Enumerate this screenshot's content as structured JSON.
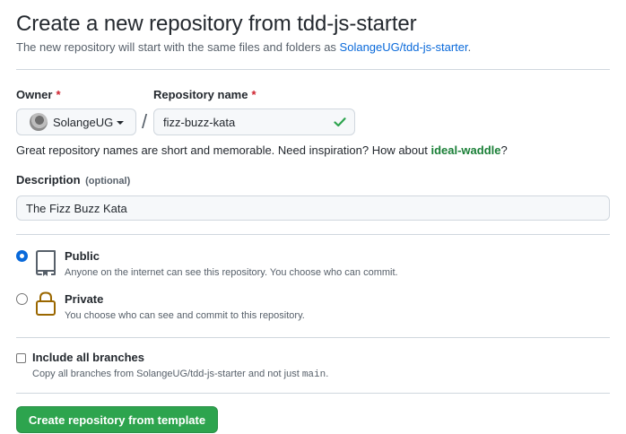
{
  "header": {
    "title": "Create a new repository from tdd-js-starter",
    "subtitle_prefix": "The new repository will start with the same files and folders as ",
    "template_link": "SolangeUG/tdd-js-starter",
    "subtitle_suffix": "."
  },
  "owner": {
    "label": "Owner",
    "required_mark": "*",
    "value": "SolangeUG"
  },
  "separator": "/",
  "repository": {
    "label": "Repository name",
    "required_mark": "*",
    "value": "fizz-buzz-kata",
    "valid_icon": "check-icon",
    "hint_prefix": "Great repository names are short and memorable. Need inspiration? How about ",
    "suggestion": "ideal-waddle",
    "hint_suffix": "?"
  },
  "description": {
    "label": "Description",
    "optional": "(optional)",
    "value": "The Fizz Buzz Kata"
  },
  "visibility": {
    "selected": "public",
    "options": [
      {
        "id": "public",
        "title": "Public",
        "desc": "Anyone on the internet can see this repository. You choose who can commit.",
        "icon": "repo-icon"
      },
      {
        "id": "private",
        "title": "Private",
        "desc": "You choose who can see and commit to this repository.",
        "icon": "lock-icon"
      }
    ]
  },
  "branches": {
    "label": "Include all branches",
    "checked": false,
    "desc_prefix": "Copy all branches from SolangeUG/tdd-js-starter and not just ",
    "desc_code": "main",
    "desc_suffix": "."
  },
  "submit": {
    "label": "Create repository from template"
  },
  "colors": {
    "link": "#0969da",
    "suggestion": "#1a7f37",
    "required": "#cf222e",
    "primary_button": "#2da44e",
    "radio_selected": "#0969da",
    "lock_icon": "#9a6700"
  }
}
